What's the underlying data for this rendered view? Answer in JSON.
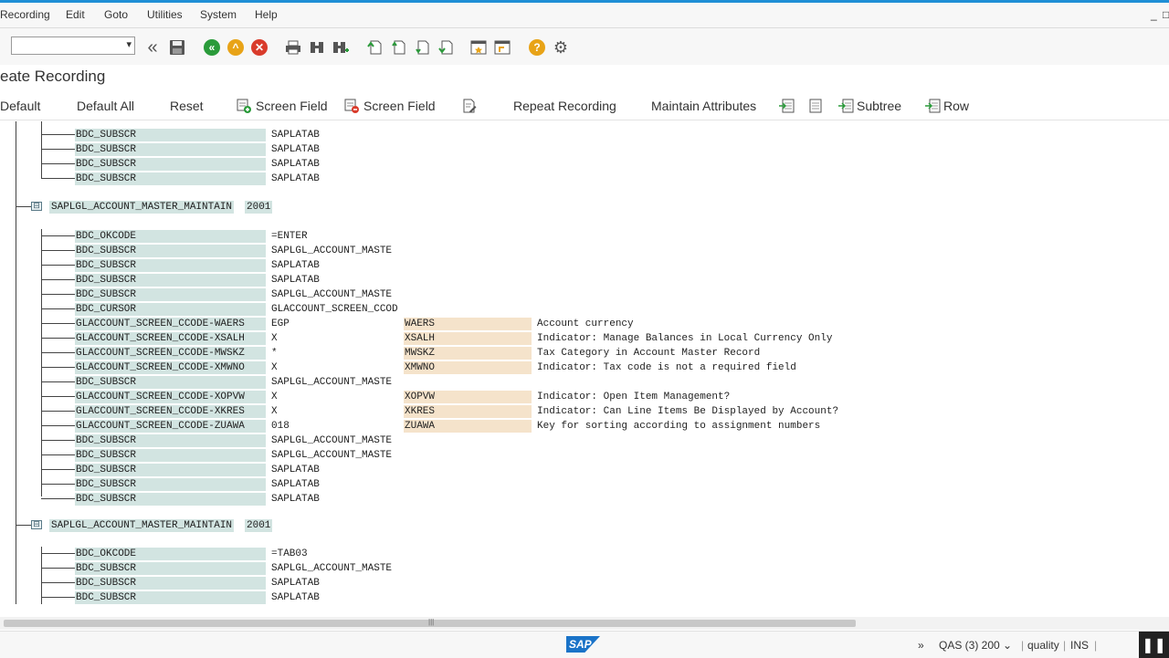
{
  "menu": [
    "Recording",
    "Edit",
    "Goto",
    "Utilities",
    "System",
    "Help"
  ],
  "window_controls": {
    "minimize": "_",
    "restore": "□"
  },
  "command_field": {
    "value": ""
  },
  "toolbar_icons": [
    "back-nav-icon",
    "save-icon",
    "back-icon",
    "exit-icon",
    "cancel-icon",
    "print-icon",
    "find-icon",
    "find-next-icon",
    "first-page-icon",
    "previous-page-icon",
    "next-page-icon",
    "last-page-icon",
    "create-session-icon",
    "shortcut-icon",
    "help-icon",
    "settings-icon"
  ],
  "title": "eate Recording",
  "app_toolbar": {
    "default": "Default",
    "default_all": "Default All",
    "reset": "Reset",
    "insert_screen_field": "Screen Field",
    "delete_screen_field": "Screen Field",
    "repeat_recording": "Repeat Recording",
    "maintain_attributes": "Maintain Attributes",
    "subtree": "Subtree",
    "row": "Row"
  },
  "group_top_rows": [
    {
      "field": "BDC_SUBSCR",
      "value": "SAPLATAB"
    },
    {
      "field": "BDC_SUBSCR",
      "value": "SAPLATAB"
    },
    {
      "field": "BDC_SUBSCR",
      "value": "SAPLATAB"
    },
    {
      "field": "BDC_SUBSCR",
      "value": "SAPLATAB"
    }
  ],
  "screen1": {
    "program": "SAPLGL_ACCOUNT_MASTER_MAINTAIN",
    "dynpro": "2001",
    "rows": [
      {
        "field": "BDC_OKCODE",
        "value": "=ENTER",
        "name": "",
        "desc": ""
      },
      {
        "field": "BDC_SUBSCR",
        "value": "SAPLGL_ACCOUNT_MASTE",
        "name": "",
        "desc": ""
      },
      {
        "field": "BDC_SUBSCR",
        "value": "SAPLATAB",
        "name": "",
        "desc": ""
      },
      {
        "field": "BDC_SUBSCR",
        "value": "SAPLATAB",
        "name": "",
        "desc": ""
      },
      {
        "field": "BDC_SUBSCR",
        "value": "SAPLGL_ACCOUNT_MASTE",
        "name": "",
        "desc": ""
      },
      {
        "field": "BDC_CURSOR",
        "value": "GLACCOUNT_SCREEN_CCOD",
        "name": "",
        "desc": ""
      },
      {
        "field": "GLACCOUNT_SCREEN_CCODE-WAERS",
        "value": "EGP",
        "name": "WAERS",
        "desc": "Account currency"
      },
      {
        "field": "GLACCOUNT_SCREEN_CCODE-XSALH",
        "value": "X",
        "name": "XSALH",
        "desc": "Indicator: Manage Balances in Local Currency Only"
      },
      {
        "field": "GLACCOUNT_SCREEN_CCODE-MWSKZ",
        "value": "*",
        "name": "MWSKZ",
        "desc": "Tax Category in Account Master Record"
      },
      {
        "field": "GLACCOUNT_SCREEN_CCODE-XMWNO",
        "value": "X",
        "name": "XMWNO",
        "desc": "Indicator: Tax code is not a required field"
      },
      {
        "field": "BDC_SUBSCR",
        "value": "SAPLGL_ACCOUNT_MASTE",
        "name": "",
        "desc": ""
      },
      {
        "field": "GLACCOUNT_SCREEN_CCODE-XOPVW",
        "value": "X",
        "name": "XOPVW",
        "desc": "Indicator: Open Item Management?"
      },
      {
        "field": "GLACCOUNT_SCREEN_CCODE-XKRES",
        "value": "X",
        "name": "XKRES",
        "desc": "Indicator: Can Line Items Be Displayed by Account?"
      },
      {
        "field": "GLACCOUNT_SCREEN_CCODE-ZUAWA",
        "value": "018",
        "name": "ZUAWA",
        "desc": "Key for sorting according to assignment numbers"
      },
      {
        "field": "BDC_SUBSCR",
        "value": "SAPLGL_ACCOUNT_MASTE",
        "name": "",
        "desc": ""
      },
      {
        "field": "BDC_SUBSCR",
        "value": "SAPLGL_ACCOUNT_MASTE",
        "name": "",
        "desc": ""
      },
      {
        "field": "BDC_SUBSCR",
        "value": "SAPLATAB",
        "name": "",
        "desc": ""
      },
      {
        "field": "BDC_SUBSCR",
        "value": "SAPLATAB",
        "name": "",
        "desc": ""
      },
      {
        "field": "BDC_SUBSCR",
        "value": "SAPLATAB",
        "name": "",
        "desc": ""
      }
    ]
  },
  "screen2": {
    "program": "SAPLGL_ACCOUNT_MASTER_MAINTAIN",
    "dynpro": "2001",
    "rows": [
      {
        "field": "BDC_OKCODE",
        "value": "=TAB03"
      },
      {
        "field": "BDC_SUBSCR",
        "value": "SAPLGL_ACCOUNT_MASTE"
      },
      {
        "field": "BDC_SUBSCR",
        "value": "SAPLATAB"
      },
      {
        "field": "BDC_SUBSCR",
        "value": "SAPLATAB"
      }
    ]
  },
  "status": {
    "chevron": "»",
    "system": "QAS (3) 200",
    "server": "quality",
    "mode": "INS"
  },
  "colors": {
    "accent": "#1f8fd6",
    "label_bg": "#d2e4e1",
    "field_bg": "#f5e3cb"
  }
}
